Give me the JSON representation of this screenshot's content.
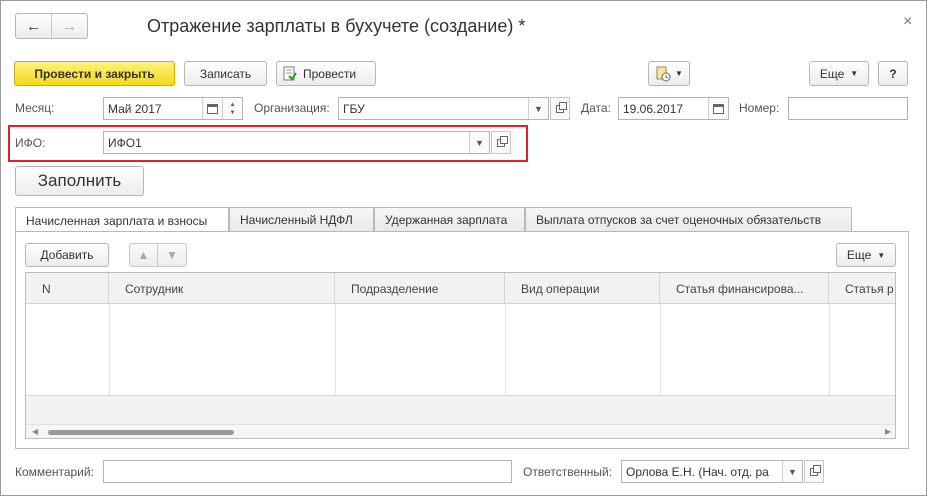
{
  "window": {
    "title": "Отражение зарплаты в бухучете (создание) *",
    "close_glyph": "×",
    "nav_back": "←",
    "nav_forward": "→"
  },
  "toolbar": {
    "post_and_close": "Провести и закрыть",
    "save": "Записать",
    "post": "Провести",
    "more": "Еще",
    "help": "?"
  },
  "form": {
    "month_label": "Месяц:",
    "month_value": "Май 2017",
    "org_label": "Организация:",
    "org_value": "ГБУ",
    "date_label": "Дата:",
    "date_value": "19.06.2017",
    "number_label": "Номер:",
    "number_value": "",
    "ifo_label": "ИФО:",
    "ifo_value": "ИФО1",
    "fill_button": "Заполнить"
  },
  "tabs": [
    {
      "label": "Начисленная зарплата и взносы",
      "active": true
    },
    {
      "label": "Начисленный НДФЛ",
      "active": false
    },
    {
      "label": "Удержанная зарплата",
      "active": false
    },
    {
      "label": "Выплата отпусков за счет оценочных обязательств",
      "active": false
    }
  ],
  "table": {
    "add_button": "Добавить",
    "more_button": "Еще",
    "columns": [
      "N",
      "Сотрудник",
      "Подразделение",
      "Вид операции",
      "Статья финансирова...",
      "Статья р"
    ],
    "rows": []
  },
  "footer": {
    "comment_label": "Комментарий:",
    "comment_value": "",
    "responsible_label": "Ответственный:",
    "responsible_value": "Орлова Е.Н. (Нач. отд. ра"
  },
  "colors": {
    "accent_yellow": "#f4d81f",
    "highlight_red": "#e0202a"
  }
}
